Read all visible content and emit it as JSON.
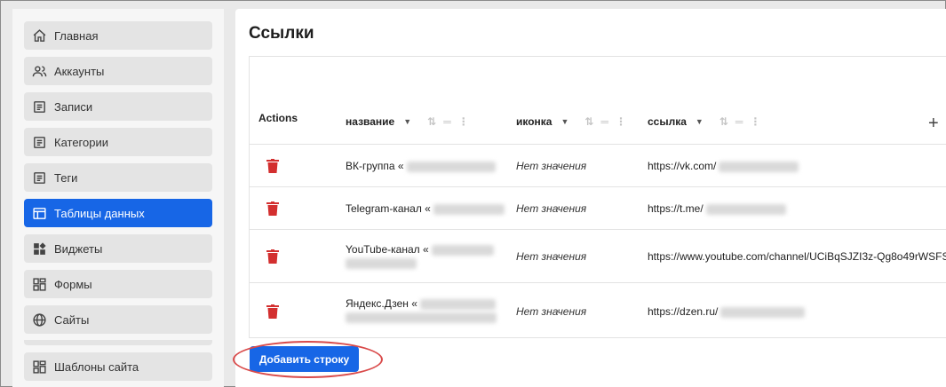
{
  "sidebar": {
    "items": [
      {
        "label": "Главная",
        "icon": "home-icon"
      },
      {
        "label": "Аккаунты",
        "icon": "users-icon"
      },
      {
        "label": "Записи",
        "icon": "document-icon"
      },
      {
        "label": "Категории",
        "icon": "document-icon"
      },
      {
        "label": "Теги",
        "icon": "document-icon"
      },
      {
        "label": "Таблицы данных",
        "icon": "table-icon",
        "active": true
      },
      {
        "label": "Виджеты",
        "icon": "widgets-icon"
      },
      {
        "label": "Формы",
        "icon": "forms-icon"
      },
      {
        "label": "Сайты",
        "icon": "globe-icon"
      },
      {
        "label": "Шаблоны сайта",
        "icon": "forms-icon"
      }
    ]
  },
  "main": {
    "title": "Ссылки",
    "table": {
      "actions_label": "Actions",
      "columns": [
        "название",
        "иконка",
        "ссылка"
      ],
      "rows": [
        {
          "name": "ВК-группа «",
          "icon": "Нет значения",
          "link": "https://vk.com/"
        },
        {
          "name": "Telegram-канал «",
          "icon": "Нет значения",
          "link": "https://t.me/"
        },
        {
          "name": "YouTube-канал «",
          "icon": "Нет значения",
          "link": "https://www.youtube.com/channel/UCiBqSJZI3z-Qg8o49rWSFS"
        },
        {
          "name": "Яндекс.Дзен «",
          "icon": "Нет значения",
          "link": "https://dzen.ru/"
        }
      ]
    },
    "add_row_label": "Добавить строку"
  },
  "colors": {
    "accent": "#1766e6",
    "delete": "#d32f2f",
    "highlight": "#d94a4a"
  }
}
